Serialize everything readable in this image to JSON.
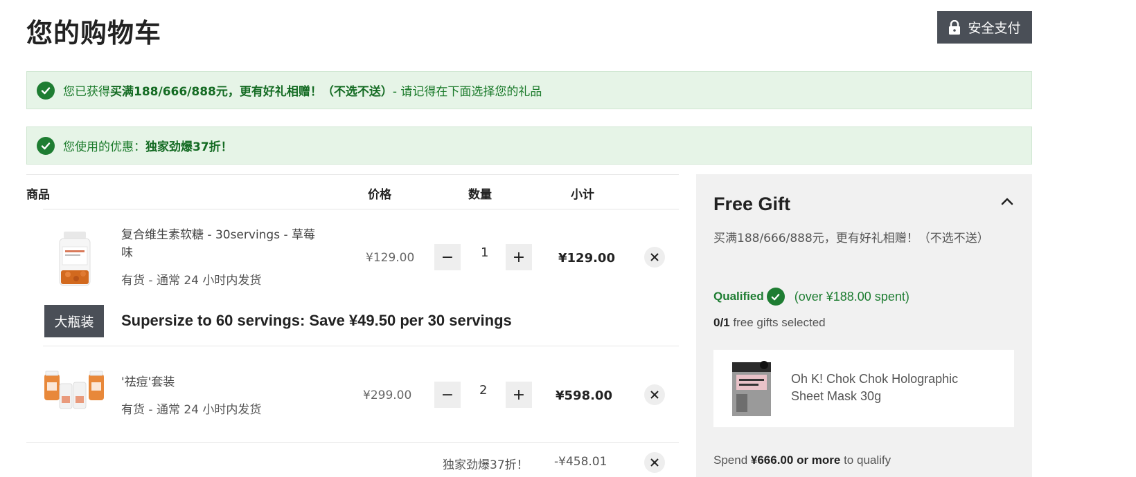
{
  "header": {
    "title": "您的购物车",
    "secure_checkout": "安全支付"
  },
  "notices": [
    {
      "prefix": "您已获得 ",
      "bold": "买满188/666/888元，更有好礼相赠！（不选不送）",
      "suffix": " - 请记得在下面选择您的礼品"
    },
    {
      "prefix": "您使用的优惠： ",
      "bold": "独家劲爆37折！",
      "suffix": ""
    }
  ],
  "table": {
    "headers": {
      "item": "商品",
      "price": "价格",
      "quantity": "数量",
      "subtotal": "小计"
    }
  },
  "items": [
    {
      "name": "复合维生素软糖 - 30servings - 草莓味",
      "stock": "有货 - 通常 24 小时内发货",
      "price": "¥129.00",
      "quantity": "1",
      "subtotal": "¥129.00",
      "minus": "−",
      "plus": "+"
    },
    {
      "name": "'祛痘'套装",
      "stock": "有货 - 通常 24 小时内发货",
      "price": "¥299.00",
      "quantity": "2",
      "subtotal": "¥598.00",
      "minus": "−",
      "plus": "+"
    }
  ],
  "upsell": {
    "badge": "大瓶装",
    "text": "Supersize to 60 servings: Save ¥49.50 per 30 servings"
  },
  "discount": {
    "label": "独家劲爆37折！",
    "value": "-¥458.01"
  },
  "gift_panel": {
    "title": "Free Gift",
    "subtitle": "买满188/666/888元，更有好礼相赠！（不选不送）",
    "qualified": "Qualified",
    "spent": "(over ¥188.00 spent)",
    "selected_count": "0/1",
    "selected_text": " free gifts selected",
    "gift_name": "Oh K! Chok Chok Holographic Sheet Mask 30g",
    "spend_prefix": "Spend ",
    "spend_bold": "¥666.00 or more",
    "spend_suffix": " to qualify"
  },
  "colors": {
    "success_bg": "#e6f4e7",
    "success_green": "#1e7d32",
    "dark_button": "#4a4f57",
    "panel_bg": "#f1f1f1"
  }
}
